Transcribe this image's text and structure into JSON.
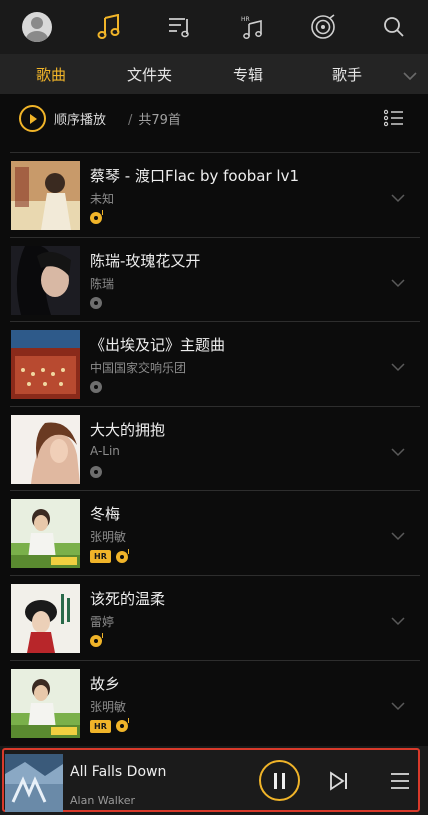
{
  "colors": {
    "accent": "#f0b429",
    "highlight": "#d93a2b",
    "background": "#0c0c0c"
  },
  "topbar": {
    "icons": [
      "avatar",
      "music-note-icon",
      "playlist-icon",
      "hr-music-icon",
      "radio-icon",
      "search-icon"
    ]
  },
  "tabs": [
    {
      "label": "歌曲",
      "active": true
    },
    {
      "label": "文件夹",
      "active": false
    },
    {
      "label": "专辑",
      "active": false
    },
    {
      "label": "歌手",
      "active": false
    }
  ],
  "playmode": {
    "label": "顺序播放",
    "separator": "/",
    "count": "共79首"
  },
  "songs": [
    {
      "title": "蔡琴 - 渡口Flac by foobar lv1",
      "artist": "未知",
      "hr": false,
      "disc": "gold"
    },
    {
      "title": "陈瑞-玫瑰花又开",
      "artist": "陈瑞",
      "hr": false,
      "disc": "gray"
    },
    {
      "title": "《出埃及记》主题曲",
      "artist": "中国国家交响乐团",
      "hr": false,
      "disc": "gray"
    },
    {
      "title": "大大的拥抱",
      "artist": "A-Lin",
      "hr": false,
      "disc": "gray"
    },
    {
      "title": "冬梅",
      "artist": "张明敏",
      "hr": true,
      "disc": "gold"
    },
    {
      "title": "该死的温柔",
      "artist": "雷婷",
      "hr": false,
      "disc": "gold"
    },
    {
      "title": "故乡",
      "artist": "张明敏",
      "hr": true,
      "disc": "gold"
    }
  ],
  "badge": {
    "hr_label": "HR"
  },
  "now_playing": {
    "title": "All Falls Down",
    "artist": "Alan Walker",
    "state": "playing"
  }
}
